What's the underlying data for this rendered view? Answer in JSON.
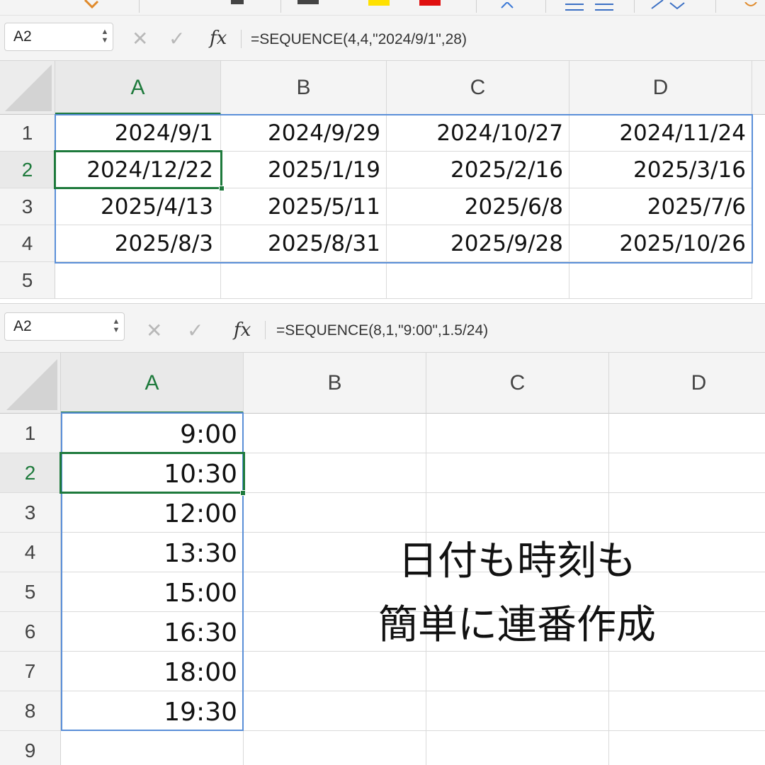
{
  "colors": {
    "accent_green": "#1e7a3c",
    "selection_blue": "#5a8fd8"
  },
  "toolbar_icons": [
    "brush-icon",
    "text-color-icon",
    "highlight-icon",
    "fill-color-icon",
    "sort-icon",
    "indent-icon",
    "wrap-icon"
  ],
  "sheet1": {
    "name_box": "A2",
    "formula": "=SEQUENCE(4,4,\"2024/9/1\",28)",
    "columns": [
      "A",
      "B",
      "C",
      "D"
    ],
    "rows": [
      "1",
      "2",
      "3",
      "4",
      "5"
    ],
    "cells": [
      [
        "2024/9/1",
        "2024/9/29",
        "2024/10/27",
        "2024/11/24"
      ],
      [
        "2024/12/22",
        "2025/1/19",
        "2025/2/16",
        "2025/3/16"
      ],
      [
        "2025/4/13",
        "2025/5/11",
        "2025/6/8",
        "2025/7/6"
      ],
      [
        "2025/8/3",
        "2025/8/31",
        "2025/9/28",
        "2025/10/26"
      ]
    ]
  },
  "sheet2": {
    "name_box": "A2",
    "formula": "=SEQUENCE(8,1,\"9:00\",1.5/24)",
    "columns": [
      "A",
      "B",
      "C",
      "D"
    ],
    "rows": [
      "1",
      "2",
      "3",
      "4",
      "5",
      "6",
      "7",
      "8",
      "9"
    ],
    "cells": [
      "9:00",
      "10:30",
      "12:00",
      "13:30",
      "15:00",
      "16:30",
      "18:00",
      "19:30"
    ]
  },
  "caption": {
    "line1": "日付も時刻も",
    "line2": "簡単に連番作成"
  }
}
